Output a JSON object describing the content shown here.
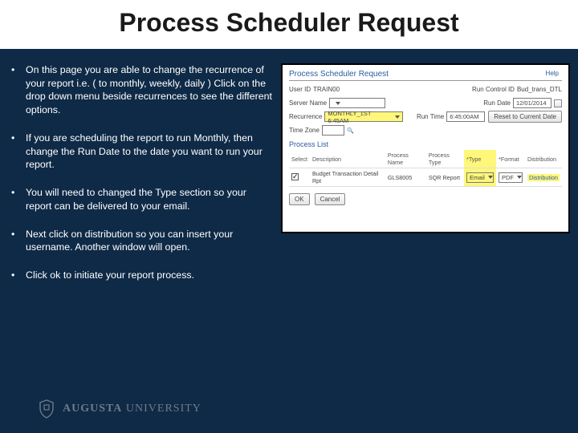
{
  "title": "Process Scheduler Request",
  "bullets": [
    "On this page you are able to change the recurrence of your report i.e. ( to monthly, weekly, daily ) Click on the drop down menu beside recurrences to see the different options.",
    "If you are scheduling the report to run Monthly, then change the Run Date to the date you want to run your report.",
    "You will need to changed the Type section so your report can be delivered to your email.",
    "Next click on distribution so you can insert your username. Another window will open.",
    "Click ok to initiate your report process."
  ],
  "screenshot": {
    "windowTitle": "Process Scheduler Request",
    "helpLink": "Help",
    "userIdLabel": "User ID",
    "userIdValue": "TRAIN00",
    "runControlLabel": "Run Control ID",
    "runControlValue": "Bud_trans_DTL",
    "serverNameLabel": "Server Name",
    "serverNameValue": "",
    "runDateLabel": "Run Date",
    "runDateValue": "12/01/2014",
    "recurrenceLabel": "Recurrence",
    "recurrenceValue": "MONTHLY_1ST 6:45AM",
    "runTimeLabel": "Run Time",
    "runTimeValue": "6:45:00AM",
    "resetButton": "Reset to Current Date",
    "timeZoneLabel": "Time Zone",
    "timeZoneValue": "",
    "processListTitle": "Process List",
    "headers": {
      "select": "Select",
      "description": "Description",
      "processName": "Process Name",
      "processType": "Process Type",
      "type": "*Type",
      "format": "*Format",
      "distribution": "Distribution"
    },
    "row": {
      "selected": true,
      "description": "Budget Transaction Detail Rpt",
      "processName": "GLS8005",
      "processType": "SQR Report",
      "type": "Email",
      "format": "PDF",
      "distribution": "Distribution"
    },
    "okLabel": "OK",
    "cancelLabel": "Cancel"
  },
  "footer": {
    "university": "AUGUSTA",
    "sub": " UNIVERSITY"
  }
}
